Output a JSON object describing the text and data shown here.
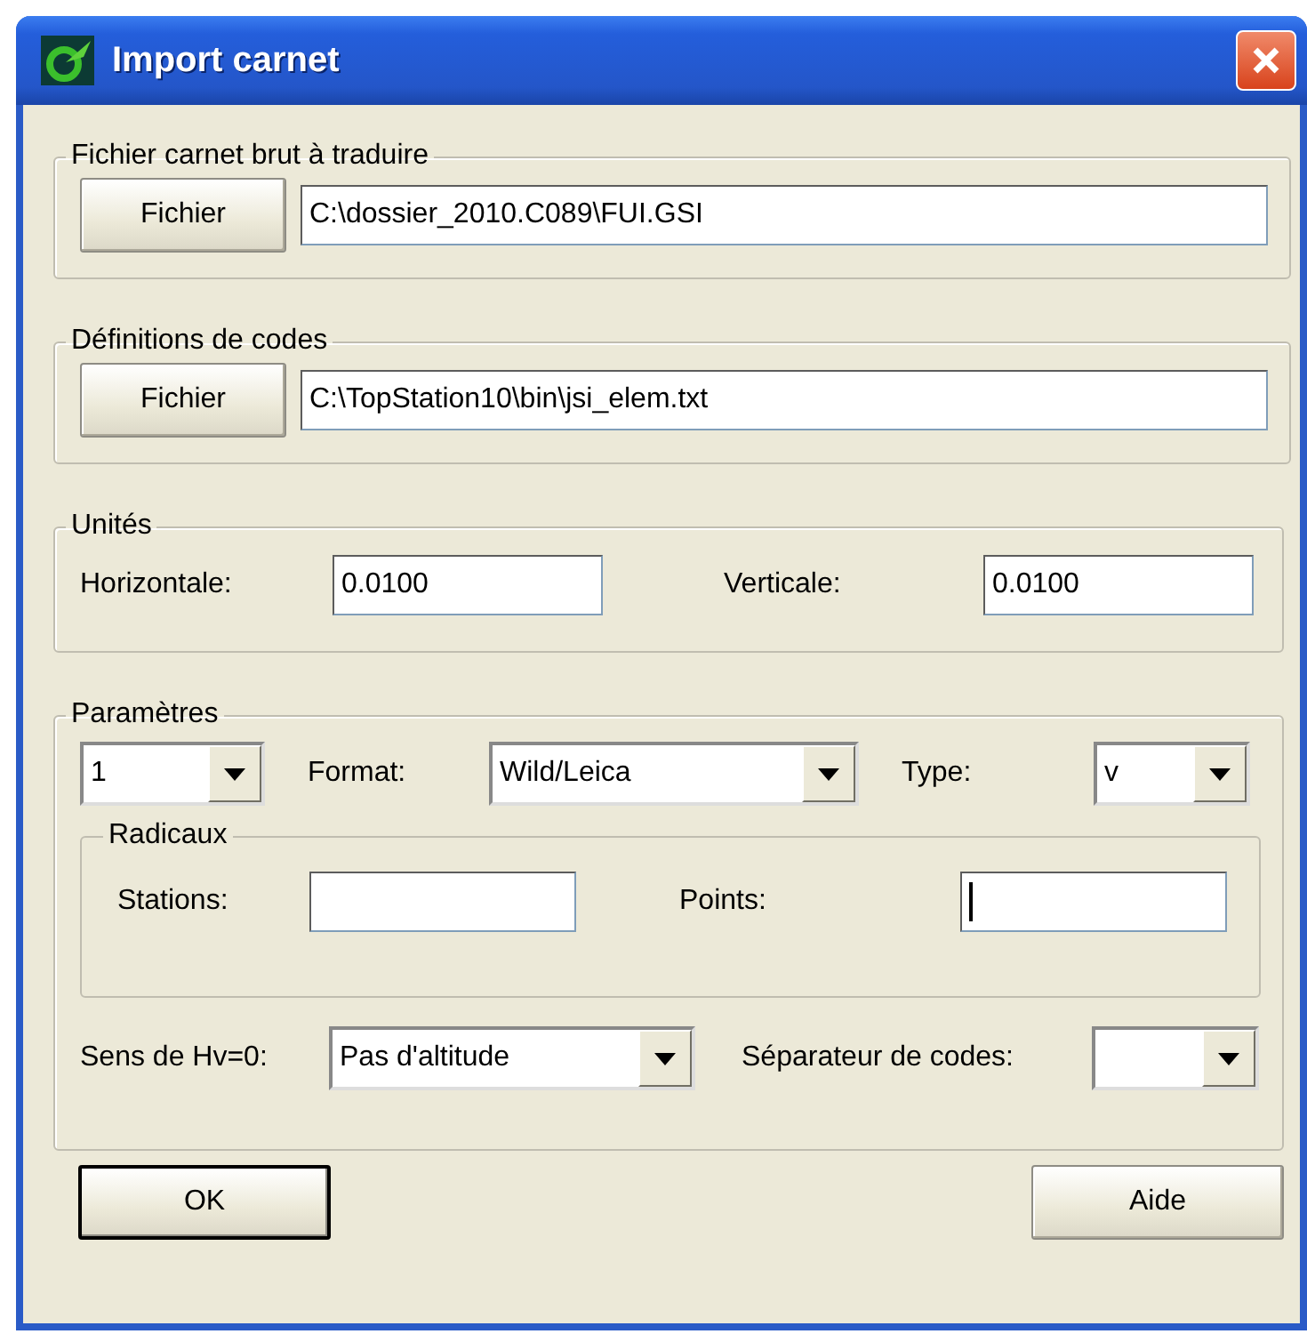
{
  "window": {
    "title": "Import carnet"
  },
  "file_groups": [
    {
      "legend": "Fichier carnet brut à traduire",
      "button": "Fichier",
      "value": "C:\\dossier_2010.C089\\FUI.GSI"
    },
    {
      "legend": "Définitions de codes",
      "button": "Fichier",
      "value": "C:\\TopStation10\\bin\\jsi_elem.txt"
    }
  ],
  "units": {
    "legend": "Unités",
    "fields": [
      {
        "label": "Horizontale:",
        "value": "0.0100"
      },
      {
        "label": "Verticale:",
        "value": "0.0100"
      }
    ]
  },
  "parameters": {
    "legend": "Paramètres",
    "top_row": [
      {
        "value": "1"
      },
      {
        "label": "Format:",
        "value": "Wild/Leica"
      },
      {
        "label": "Type:",
        "value": "v"
      }
    ],
    "radicaux": {
      "legend": "Radicaux",
      "fields": [
        {
          "label": "Stations:",
          "focused": false
        },
        {
          "label": "Points:",
          "focused": true
        }
      ]
    },
    "bottom_row": [
      {
        "label": "Sens de Hv=0:",
        "value": "Pas d'altitude"
      },
      {
        "label": "Séparateur de codes:"
      }
    ]
  },
  "buttons": [
    {
      "label": "OK",
      "default": true
    },
    {
      "label": "Aide",
      "default": false
    }
  ]
}
